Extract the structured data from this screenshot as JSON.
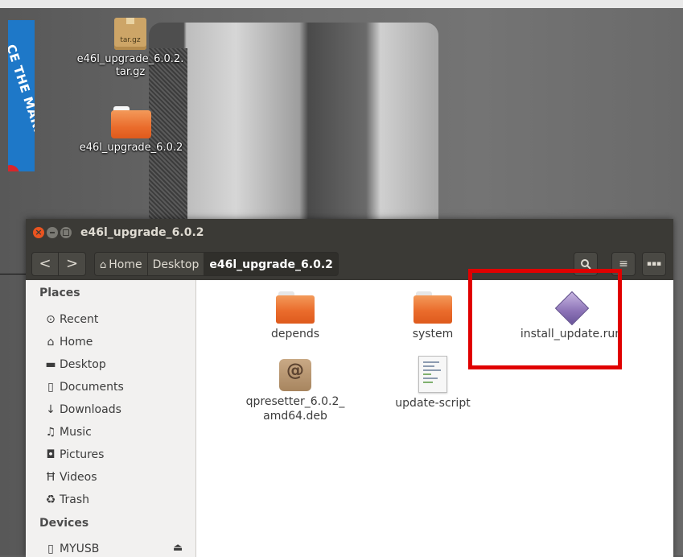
{
  "desktop": {
    "poster_text": "CE THE MARK",
    "icons": [
      {
        "name": "tar-gz-archive",
        "label": "e46l_upgrade_6.0.2.\ntar.gz",
        "badge": "tar.gz"
      },
      {
        "name": "folder",
        "label": "e46l_upgrade_6.0.2"
      }
    ]
  },
  "window": {
    "title": "e46l_upgrade_6.0.2",
    "close_glyph": "×"
  },
  "toolbar": {
    "back_glyph": "<",
    "forward_glyph": ">",
    "breadcrumbs": [
      {
        "label": "Home",
        "icon": "home-icon"
      },
      {
        "label": "Desktop"
      },
      {
        "label": "e46l_upgrade_6.0.2"
      }
    ],
    "search_glyph": "🔍",
    "list_view_glyph": "≡",
    "grid_view_glyph": "⋮⋮⋮"
  },
  "sidebar": {
    "places_heading": "Places",
    "places": [
      {
        "label": "Recent",
        "icon": "clock-icon",
        "glyph": "⊙"
      },
      {
        "label": "Home",
        "icon": "home-icon",
        "glyph": "⌂"
      },
      {
        "label": "Desktop",
        "icon": "folder-icon",
        "glyph": "▬"
      },
      {
        "label": "Documents",
        "icon": "document-icon",
        "glyph": "▯"
      },
      {
        "label": "Downloads",
        "icon": "download-icon",
        "glyph": "↓"
      },
      {
        "label": "Music",
        "icon": "music-icon",
        "glyph": "♫"
      },
      {
        "label": "Pictures",
        "icon": "camera-icon",
        "glyph": "◘"
      },
      {
        "label": "Videos",
        "icon": "film-icon",
        "glyph": "Ħ"
      },
      {
        "label": "Trash",
        "icon": "trash-icon",
        "glyph": "♻"
      }
    ],
    "devices_heading": "Devices",
    "devices": [
      {
        "label": "MYUSB",
        "icon": "usb-drive-icon",
        "glyph": "▯",
        "eject_glyph": "⏏"
      }
    ]
  },
  "files": [
    {
      "label": "depends",
      "type": "folder"
    },
    {
      "label": "system",
      "type": "folder"
    },
    {
      "label": "install_update.run",
      "type": "executable"
    },
    {
      "label": "qpresetter_6.0.2_\namd64.deb",
      "type": "deb-package"
    },
    {
      "label": "update-script",
      "type": "script"
    }
  ],
  "colors": {
    "titlebar": "#3b3a36",
    "folder_orange": "#ea6c2c",
    "highlight_red": "#e00000",
    "sidebar_bg": "#f2f1f0"
  }
}
